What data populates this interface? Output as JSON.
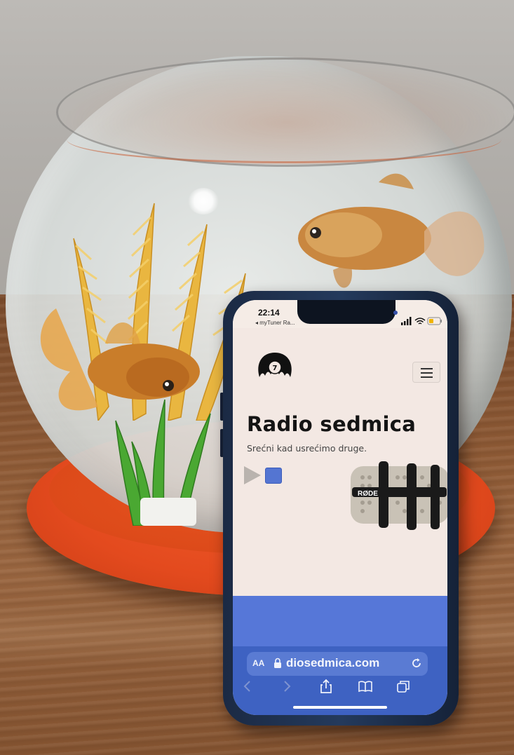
{
  "status_bar": {
    "time": "22:14",
    "back_app": "◂ myTuner Ra..."
  },
  "site": {
    "title": "Radio sedmica",
    "tagline": "Srećni kad usrećimo druge.",
    "logo_text": "7",
    "mic_brand": "RØDE"
  },
  "browser": {
    "text_size_label": "AA",
    "url": "diosedmica.com"
  },
  "colors": {
    "accent_blue": "#5677d8",
    "browser_blue": "#3e62c2",
    "page_bg": "#f3e8e3",
    "plate_orange": "#e34a1e"
  },
  "icons": [
    "lock-icon",
    "reload-icon",
    "back-icon",
    "forward-icon",
    "share-icon",
    "bookmarks-icon",
    "tabs-icon",
    "hamburger-menu-icon",
    "play-icon",
    "stop-icon"
  ]
}
